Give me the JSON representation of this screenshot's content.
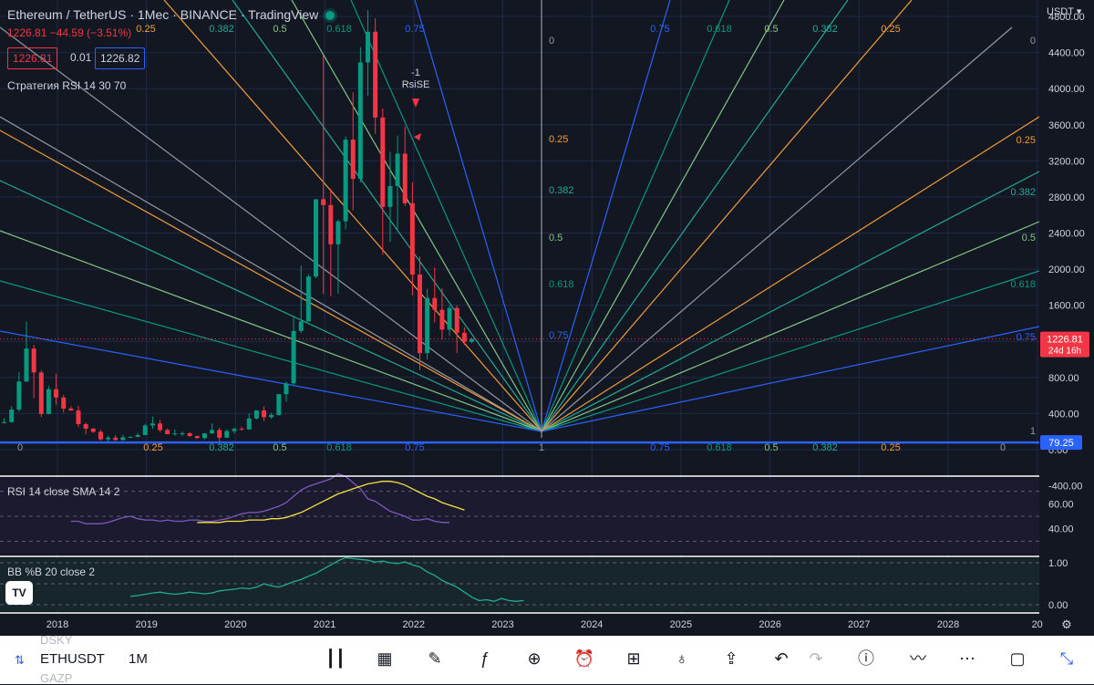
{
  "header": {
    "title": "Ethereum / TetherUS · 1Мес · BINANCE · TradingView",
    "ohlc": "1226.81 −44.59 (−3.51%)",
    "sell_price": "1226.81",
    "spread": "0.01",
    "buy_price": "1226.82",
    "strategy": "Стратегия RSI 14 30 70"
  },
  "colors": {
    "background": "#131722",
    "up": "#089981",
    "down": "#f23645",
    "blue": "#2962ff",
    "fan_0": "#9598a1",
    "fan_025": "#f29d38",
    "fan_0382": "#22ab94",
    "fan_05": "#81c784",
    "fan_0618": "#089981",
    "fan_075": "#2962ff",
    "rsi": "#7e57c2",
    "rsi_sma": "#f7e040",
    "bb": "#22ab94"
  },
  "chart_data": [
    {
      "type": "candlestick",
      "title": "Ethereum / TetherUS · 1Мес · BINANCE",
      "ylabel": "USDT",
      "ylim": [
        -400,
        5000
      ],
      "y_ticks": [
        "4800.00",
        "4400.00",
        "4000.00",
        "3600.00",
        "3200.00",
        "2800.00",
        "2400.00",
        "2000.00",
        "1600.00",
        "1200.00",
        "800.00",
        "400.00",
        "0.00",
        "-400.00"
      ],
      "x_ticks": [
        "2018",
        "2019",
        "2020",
        "2021",
        "2022",
        "2023",
        "2024",
        "2025",
        "2026",
        "2027",
        "2028",
        "20"
      ],
      "last_price_label": "1226.81",
      "last_price_countdown": "24d 16h",
      "horizontal_line_label": "79.25",
      "horizontal_line_value": 79.25,
      "strategy_signal_labels": [
        "-1",
        "RsiSE"
      ],
      "series": [
        {
          "name": "ETHUSDT",
          "x": [
            "2017-08",
            "2017-09",
            "2017-10",
            "2017-11",
            "2017-12",
            "2018-01",
            "2018-02",
            "2018-03",
            "2018-04",
            "2018-05",
            "2018-06",
            "2018-07",
            "2018-08",
            "2018-09",
            "2018-10",
            "2018-11",
            "2018-12",
            "2019-01",
            "2019-02",
            "2019-03",
            "2019-04",
            "2019-05",
            "2019-06",
            "2019-07",
            "2019-08",
            "2019-09",
            "2019-10",
            "2019-11",
            "2019-12",
            "2020-01",
            "2020-02",
            "2020-03",
            "2020-04",
            "2020-05",
            "2020-06",
            "2020-07",
            "2020-08",
            "2020-09",
            "2020-10",
            "2020-11",
            "2020-12",
            "2021-01",
            "2021-02",
            "2021-03",
            "2021-04",
            "2021-05",
            "2021-06",
            "2021-07",
            "2021-08",
            "2021-09",
            "2021-10",
            "2021-11",
            "2021-12",
            "2022-01",
            "2022-02",
            "2022-03",
            "2022-04",
            "2022-05",
            "2022-06",
            "2022-07",
            "2022-08",
            "2022-09",
            "2022-10",
            "2022-11",
            "2022-12",
            "2023-01"
          ],
          "open": [
            300,
            388,
            303,
            305,
            445,
            755,
            1120,
            855,
            395,
            670,
            578,
            455,
            434,
            283,
            233,
            198,
            115,
            133,
            107,
            137,
            141,
            162,
            268,
            290,
            218,
            172,
            180,
            182,
            151,
            129,
            180,
            218,
            133,
            206,
            230,
            225,
            345,
            435,
            360,
            385,
            615,
            735,
            1315,
            1420,
            1918,
            2775,
            2710,
            2275,
            2530,
            3435,
            3000,
            4290,
            4630,
            3680,
            2690,
            2920,
            3280,
            2730,
            1940,
            1070,
            1680,
            1550,
            1330,
            1570,
            1295,
            1195
          ],
          "high": [
            395,
            395,
            350,
            480,
            860,
            1420,
            1160,
            880,
            705,
            840,
            605,
            480,
            485,
            300,
            240,
            220,
            155,
            160,
            165,
            150,
            185,
            285,
            365,
            330,
            235,
            225,
            200,
            195,
            155,
            185,
            290,
            245,
            225,
            245,
            255,
            400,
            435,
            480,
            410,
            620,
            755,
            1475,
            2040,
            1945,
            2760,
            4370,
            2890,
            2550,
            3470,
            3960,
            4460,
            4870,
            4780,
            3780,
            3300,
            3480,
            3580,
            2960,
            2140,
            1780,
            2020,
            1790,
            1600,
            1600,
            1355,
            1240
          ],
          "low": [
            135,
            200,
            290,
            300,
            420,
            750,
            570,
            360,
            390,
            500,
            410,
            430,
            250,
            170,
            185,
            100,
            80,
            100,
            100,
            130,
            140,
            160,
            230,
            195,
            175,
            155,
            150,
            140,
            120,
            115,
            175,
            90,
            130,
            175,
            215,
            220,
            335,
            315,
            340,
            375,
            530,
            715,
            1290,
            1450,
            1900,
            1725,
            1700,
            1730,
            2440,
            2650,
            2960,
            3920,
            3500,
            2160,
            2300,
            2440,
            2700,
            1710,
            880,
            1000,
            1410,
            1220,
            1260,
            1070,
            1160,
            1180
          ],
          "close": [
            388,
            303,
            305,
            445,
            755,
            1120,
            855,
            395,
            670,
            578,
            455,
            434,
            283,
            233,
            198,
            115,
            133,
            107,
            137,
            141,
            162,
            268,
            290,
            218,
            172,
            180,
            182,
            151,
            129,
            180,
            218,
            133,
            206,
            230,
            225,
            345,
            435,
            360,
            385,
            615,
            735,
            1315,
            1420,
            1918,
            2775,
            2710,
            2275,
            2530,
            3435,
            3000,
            4290,
            4630,
            3680,
            2690,
            2920,
            3280,
            2730,
            1940,
            1070,
            1680,
            1550,
            1330,
            1570,
            1295,
            1195,
            1226.81
          ]
        }
      ]
    },
    {
      "type": "gann_fan",
      "levels_left": [
        "0",
        "0.25",
        "0.382",
        "0.5",
        "0.618",
        "0.75"
      ],
      "levels_right": [
        "0.75",
        "0.618",
        "0.5",
        "0.382",
        "0.25",
        "0"
      ],
      "pivot_label": "1",
      "side_labels": [
        "0",
        "0.25",
        "0.382",
        "0.5",
        "0.618",
        "0.75"
      ],
      "side_labels_right": [
        "0",
        "0.25",
        "0.382",
        "0.5",
        "0.618",
        "0.75"
      ],
      "corner_label": "1"
    },
    {
      "type": "line",
      "title": "RSI 14 close SMA 14 2",
      "ylim": [
        20,
        80
      ],
      "y_ticks": [
        "60.00",
        "40.00"
      ],
      "bands": [
        70,
        50,
        30
      ],
      "series": [
        {
          "name": "RSI",
          "x_start": "2018-07",
          "values": [
            46,
            46,
            44,
            44,
            44,
            45,
            47,
            49,
            50,
            48,
            47,
            47,
            46,
            47,
            46,
            46,
            47,
            47,
            46,
            46,
            47,
            48,
            50,
            52,
            53,
            53,
            54,
            56,
            58,
            61,
            66,
            71,
            74,
            76,
            78,
            80,
            84,
            82,
            77,
            72,
            64,
            62,
            58,
            54,
            52,
            50,
            47,
            47,
            48,
            46,
            45,
            45
          ]
        },
        {
          "name": "SMA",
          "x_start": "2019-12",
          "values": [
            45,
            45,
            45,
            45,
            46,
            46,
            46,
            47,
            47,
            47,
            48,
            48,
            49,
            51,
            53,
            56,
            59,
            62,
            65,
            68,
            70,
            72,
            74,
            76,
            77,
            78,
            78,
            77,
            75,
            72,
            69,
            66,
            64,
            61,
            59,
            57,
            55
          ]
        }
      ]
    },
    {
      "type": "line",
      "title": "BB %B 20 close 2",
      "ylim": [
        -0.1,
        1.1
      ],
      "y_ticks": [
        "1.00",
        "0.00"
      ],
      "series": [
        {
          "name": "%B",
          "x_start": "2019-03",
          "values": [
            0.2,
            0.22,
            0.25,
            0.28,
            0.3,
            0.27,
            0.25,
            0.27,
            0.3,
            0.28,
            0.26,
            0.28,
            0.33,
            0.35,
            0.37,
            0.4,
            0.38,
            0.42,
            0.5,
            0.45,
            0.42,
            0.48,
            0.55,
            0.6,
            0.68,
            0.75,
            0.85,
            0.95,
            1.05,
            1.12,
            1.1,
            1.08,
            1.06,
            1.02,
            1.04,
            1.0,
            0.98,
            1.02,
            0.95,
            0.9,
            0.78,
            0.7,
            0.58,
            0.5,
            0.42,
            0.3,
            0.18,
            0.1,
            0.12,
            0.08,
            0.15,
            0.1,
            0.08,
            0.1
          ]
        }
      ]
    }
  ],
  "bottombar": {
    "ghost_above": "DSKY",
    "symbol": "ETHUSDT",
    "ghost_below": "GAZP",
    "interval": "1M",
    "icons": [
      "bar-style-icon",
      "indicators-calendar-icon",
      "drawing-icon",
      "formula-icon",
      "add-icon",
      "alert-icon",
      "layout-icon",
      "idea-icon",
      "share-icon",
      "undo-icon",
      "redo-icon",
      "info-icon",
      "trend-icon",
      "more-icon",
      "window-icon",
      "collapse-icon"
    ]
  },
  "logo": "TV"
}
